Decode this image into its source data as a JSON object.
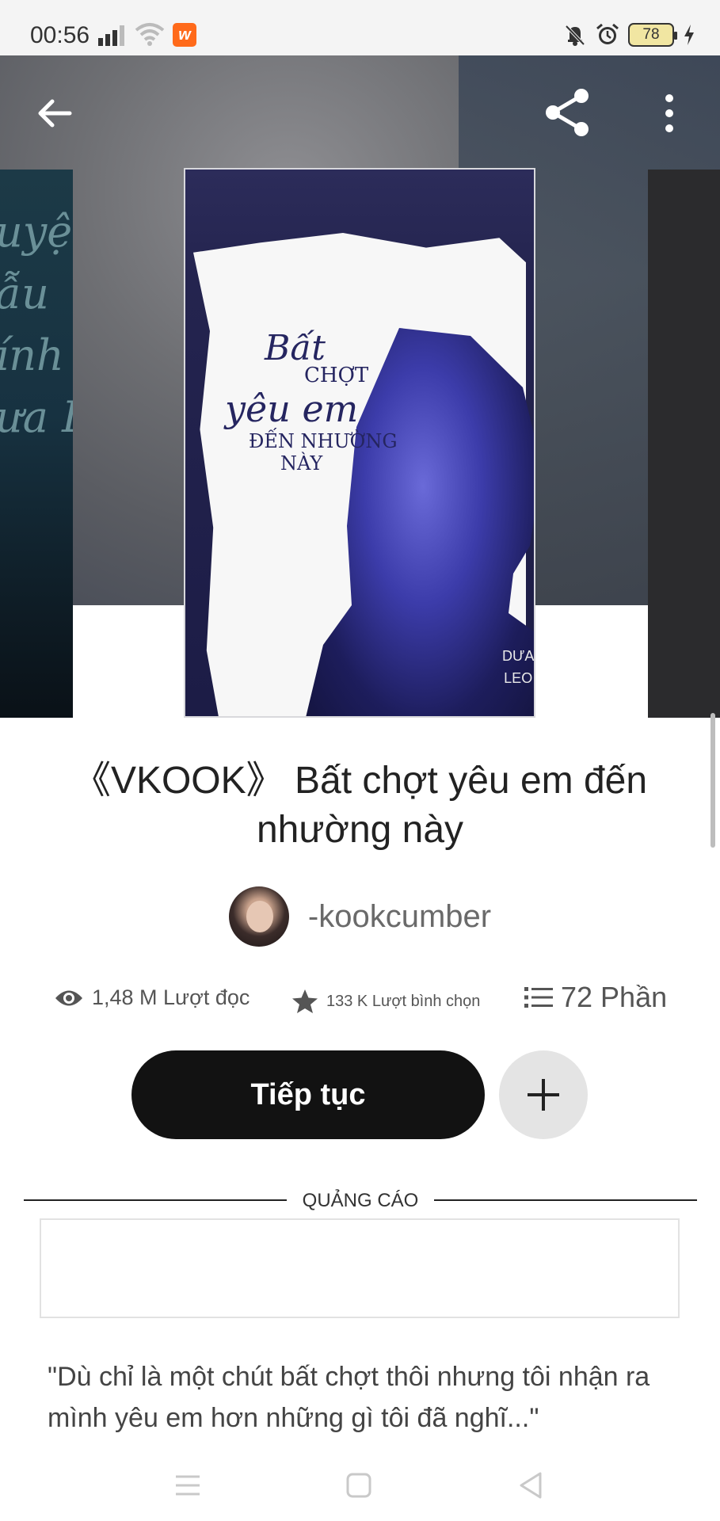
{
  "status_bar": {
    "time": "00:56",
    "app_badge": "w",
    "battery": "78"
  },
  "hero": {
    "cover_left_text": "uyệt\nẫu\nính\nưa Leo",
    "cover_main": {
      "title_line1": "Bất",
      "title_line2": "CHỢT",
      "title_line3": "yêu em",
      "title_line4": "ĐẾN NHƯỜNG",
      "title_line5": "NÀY",
      "author": "DƯA\nLEO"
    }
  },
  "book": {
    "title": "《VKOOK》 Bất chợt yêu em đến nhường này",
    "author": "-kookcumber"
  },
  "stats": {
    "reads": "1,48 M Lượt đọc",
    "votes": "133 K Lượt bình chọn",
    "parts": "72 Phần"
  },
  "actions": {
    "continue_label": "Tiếp tục"
  },
  "ad": {
    "label": "QUẢNG CÁO"
  },
  "description": "\"Dù chỉ là một chút bất chợt thôi nhưng tôi nhận ra mình yêu em hơn những gì tôi đã nghĩ...\"",
  "colors": {
    "primary_button": "#121212",
    "secondary_button": "#e4e4e4",
    "app_badge": "#ff6a1a"
  }
}
